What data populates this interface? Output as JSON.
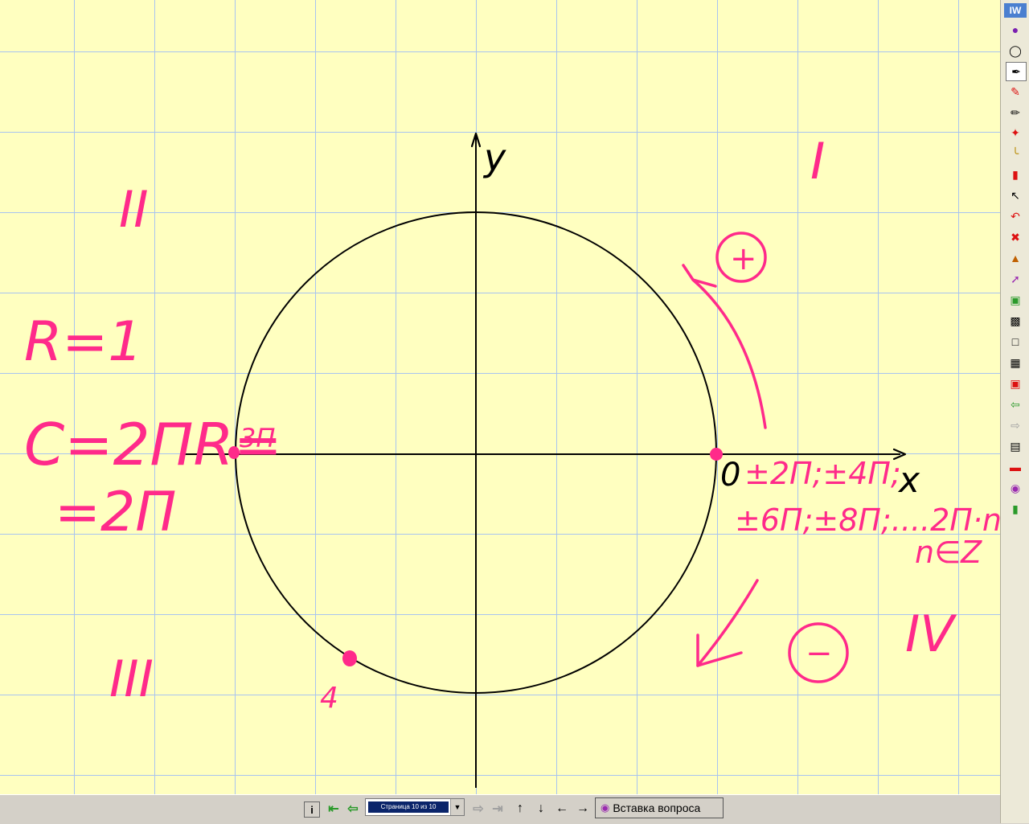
{
  "toolbar": {
    "logo": "IW",
    "tools": [
      "info-icon",
      "mouse-icon",
      "pen-icon",
      "highlighter-icon",
      "brush-icon",
      "magic-pen-icon",
      "ruler-icon",
      "eraser-icon",
      "select-icon",
      "undo-icon",
      "delete-icon",
      "stamp-icon",
      "pointer-icon",
      "camera-icon",
      "snapshot-icon",
      "blank-page-icon",
      "grid-page-icon",
      "image-page-icon",
      "prev-page-icon",
      "next-page-icon",
      "flipchart-icon",
      "toolbox-icon",
      "help-icon",
      "exit-icon"
    ],
    "accent": "#4a7fd0"
  },
  "board": {
    "background": "#ffffc0",
    "grid_color": "#a8c4f0",
    "ink_color": "#ff2a8a",
    "axis_x_label": "x",
    "axis_y_label": "y",
    "quadrants": {
      "q1": "I",
      "q2": "II",
      "q3": "III",
      "q4": "IV"
    },
    "radius_text": "R=1",
    "circumference_text": "C=2ПR=",
    "circumference_value": "=2П",
    "point_left_label": "3П",
    "point_bottom_label": "4",
    "point_right_label": "0",
    "periodic_line1": "±2П;±4П;",
    "periodic_line2": "±6П;±8П;....2П·n,",
    "periodic_line3": "n∈Z",
    "positive_sign": "+",
    "negative_sign": "−"
  },
  "bottombar": {
    "page_selector_value": "Страница 10 из 10",
    "insert_button_label": "Вставка вопроса"
  }
}
